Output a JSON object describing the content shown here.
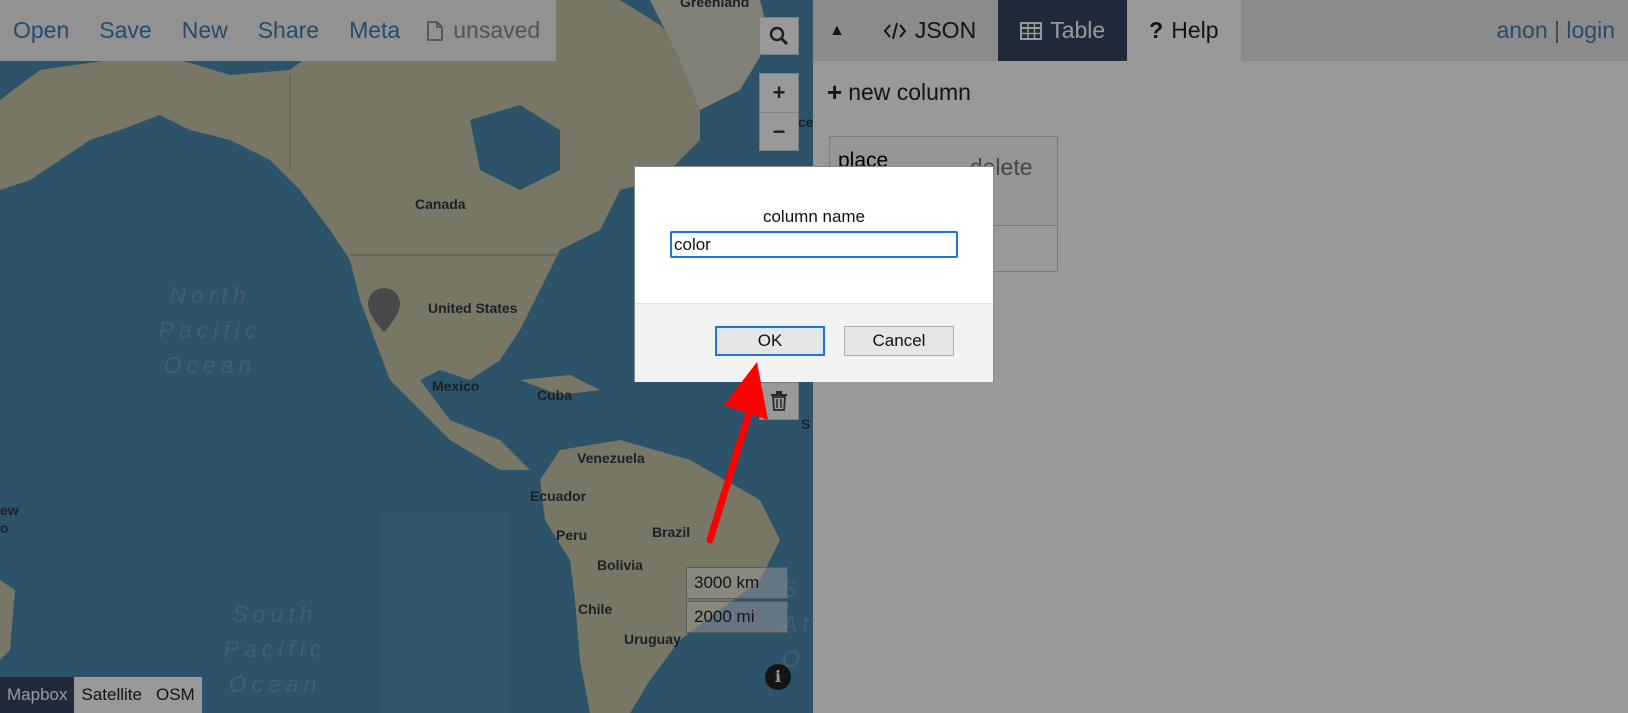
{
  "toolbar": {
    "open": "Open",
    "save": "Save",
    "new": "New",
    "share": "Share",
    "meta": "Meta",
    "file_status": "unsaved",
    "file_icon": "file-icon"
  },
  "map": {
    "labels": {
      "greenland": "Greenland",
      "canada": "Canada",
      "united_states": "United States",
      "mexico": "Mexico",
      "cuba": "Cuba",
      "venezuela": "Venezuela",
      "ecuador": "Ecuador",
      "brazil": "Brazil",
      "peru": "Peru",
      "bolivia": "Bolivia",
      "chile": "Chile",
      "uruguay": "Uruguay",
      "edge_left_1": "ew",
      "edge_left_2": "o",
      "edge_right_1": "cel",
      "edge_right_2": "S"
    },
    "oceans": {
      "north_pacific": "North\nPacific\nOcean",
      "south_pacific": "South\nPacific\nOcean",
      "south_atlantic_partial": "S\nAtl\nO"
    },
    "controls": {
      "search_icon": "search-icon",
      "zoom_in": "+",
      "zoom_out": "−",
      "trash_icon": "trash-icon",
      "info": "i"
    },
    "scale": {
      "km": "3000 km",
      "mi": "2000 mi"
    },
    "layers": [
      "Mapbox",
      "Satellite",
      "OSM"
    ],
    "active_layer": "Mapbox"
  },
  "right_pane": {
    "tabs": {
      "collapse_icon": "▲",
      "json": "JSON",
      "table": "Table",
      "help": "Help"
    },
    "active_tab": "Table",
    "auth": {
      "anon": "anon",
      "separator": "|",
      "login": "login"
    },
    "new_column": "new column",
    "table": {
      "column_name": "place",
      "delete_label": "delete"
    }
  },
  "dialog": {
    "prompt": "column name",
    "input_value": "color",
    "ok": "OK",
    "cancel": "Cancel"
  },
  "colors": {
    "accent_link": "#3c7fb4",
    "tab_active": "#34495e",
    "focus_blue": "#1a73e8",
    "annotation_arrow": "#ff0000"
  }
}
